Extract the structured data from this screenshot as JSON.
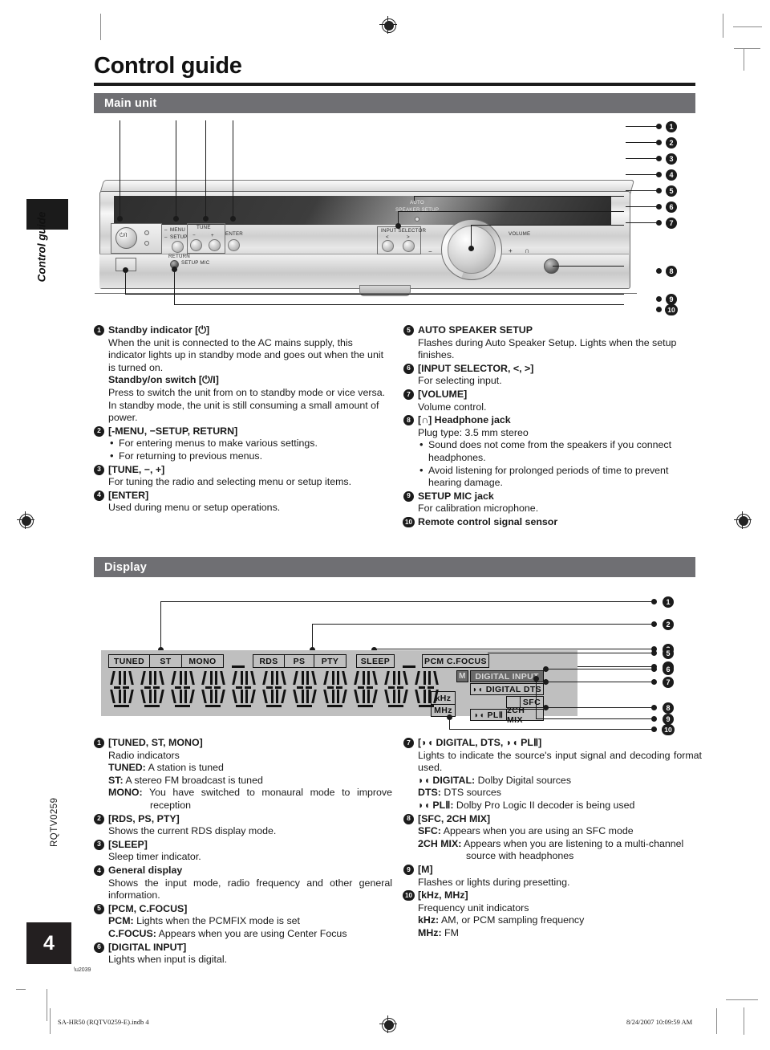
{
  "page": {
    "title": "Control guide",
    "side_tab_label": "Control guide",
    "page_number": "4",
    "doc_code": "RQTV0259"
  },
  "sections": {
    "main_unit": {
      "band_label": "Main unit"
    },
    "display": {
      "band_label": "Display"
    }
  },
  "unit_labels": {
    "menu": "MENU",
    "setup": "SETUP",
    "return": "RETURN",
    "tune": "TUNE",
    "minus": "−",
    "plus": "+",
    "enter": "ENTER",
    "setup_mic": "SETUP MIC",
    "auto": "AUTO",
    "speaker_setup": "SPEAKER SETUP",
    "input_selector": "INPUT SELECTOR",
    "left_arrow": "<",
    "right_arrow": ">",
    "volume": "VOLUME",
    "vol_minus": "−",
    "vol_plus": "+",
    "headphone": "∩",
    "power_glyph": "⏻/I",
    "standby_dot": "⏻"
  },
  "main_unit_items": [
    {
      "num": "1",
      "title": "Standby indicator [⏻]",
      "body": "When the unit is connected to the AC mains supply, this indicator lights up in standby mode and goes out when the unit is turned on.",
      "title2": "Standby/on switch [⏻/I]",
      "body2": "Press to switch the unit from on to standby mode or vice versa. In standby mode, the unit is still consuming a small amount of power."
    },
    {
      "num": "2",
      "title": "[-MENU, −SETUP, RETURN]",
      "bullets": [
        "For entering menus to make various settings.",
        "For returning to previous menus."
      ]
    },
    {
      "num": "3",
      "title": "[TUNE, −, +]",
      "body": "For tuning the radio and selecting menu or setup items."
    },
    {
      "num": "4",
      "title": "[ENTER]",
      "body": "Used during menu or setup operations."
    },
    {
      "num": "5",
      "title": "AUTO SPEAKER SETUP",
      "body": "Flashes during Auto Speaker Setup. Lights when the setup finishes."
    },
    {
      "num": "6",
      "title": "[INPUT SELECTOR, <, >]",
      "body": "For selecting input."
    },
    {
      "num": "7",
      "title": "[VOLUME]",
      "body": "Volume control."
    },
    {
      "num": "8",
      "title": "[∩] Headphone jack",
      "body": "Plug type: 3.5 mm stereo",
      "bullets": [
        "Sound does not come from the speakers if you connect headphones.",
        "Avoid listening for prolonged periods of time to prevent hearing damage."
      ]
    },
    {
      "num": "9",
      "title": "SETUP MIC jack",
      "body": "For calibration microphone."
    },
    {
      "num": "10",
      "title": "Remote control signal sensor"
    }
  ],
  "display_items": [
    {
      "num": "1",
      "title": "[TUNED, ST, MONO]",
      "body": "Radio indicators",
      "defs": [
        {
          "term": "TUNED:",
          "desc": "A station is tuned"
        },
        {
          "term": "ST:",
          "desc": "A stereo FM broadcast is tuned"
        },
        {
          "term": "MONO:",
          "desc": "You have switched to monaural mode to improve reception"
        }
      ]
    },
    {
      "num": "2",
      "title": "[RDS, PS, PTY]",
      "body": "Shows the current RDS display mode."
    },
    {
      "num": "3",
      "title": "[SLEEP]",
      "body": "Sleep timer indicator."
    },
    {
      "num": "4",
      "title": "General display",
      "body": "Shows the input mode, radio frequency and other general information."
    },
    {
      "num": "5",
      "title": "[PCM, C.FOCUS]",
      "defs": [
        {
          "term": "PCM:",
          "desc": "Lights when the PCMFIX mode is set"
        },
        {
          "term": "C.FOCUS:",
          "desc": "Appears when you are using Center Focus"
        }
      ]
    },
    {
      "num": "6",
      "title": "[DIGITAL INPUT]",
      "body": "Lights when input is digital."
    },
    {
      "num": "7",
      "title": "[◗◖ DIGITAL, DTS, ◗◖ PLⅡ]",
      "body": "Lights to indicate the source's input signal and decoding format used.",
      "defs": [
        {
          "term": "◗◖ DIGITAL:",
          "desc": "Dolby Digital sources"
        },
        {
          "term": "DTS:",
          "desc": "DTS sources"
        },
        {
          "term": "◗◖ PLⅡ:",
          "desc": "Dolby Pro Logic II decoder is being used"
        }
      ]
    },
    {
      "num": "8",
      "title": "[SFC, 2CH MIX]",
      "defs": [
        {
          "term": "SFC:",
          "desc": "Appears when you are using an SFC mode"
        },
        {
          "term": "2CH MIX:",
          "desc": "Appears when you are listening to a multi-channel source with headphones"
        }
      ]
    },
    {
      "num": "9",
      "title": "[M]",
      "body": "Flashes or lights during presetting."
    },
    {
      "num": "10",
      "title": "[kHz, MHz]",
      "body": "Frequency unit indicators",
      "defs": [
        {
          "term": "kHz:",
          "desc": "AM, or PCM sampling frequency"
        },
        {
          "term": "MHz:",
          "desc": "FM"
        }
      ]
    }
  ],
  "display_panel": {
    "indicators_row1": [
      "TUNED",
      "ST",
      "MONO"
    ],
    "indicators_row2": [
      "RDS",
      "PS",
      "PTY"
    ],
    "sleep": "SLEEP",
    "pcm_cfocus": "PCM  C.FOCUS",
    "m_flag": "M",
    "digital_input": "DIGITAL INPUT",
    "dolby_digital": "◗◖ DIGITAL   DTS",
    "sfc": "SFC",
    "pl2_2chmix_left": "◗◖ PLⅡ",
    "pl2_2chmix_right": "2CH MIX",
    "khz": "kHz",
    "mhz": "MHz",
    "digit_count": 11
  },
  "callouts": {
    "main_unit": [
      "1",
      "2",
      "3",
      "4",
      "5",
      "6",
      "7",
      "8",
      "9",
      "10"
    ],
    "display": [
      "1",
      "2",
      "3",
      "4",
      "5",
      "6",
      "7",
      "8",
      "9",
      "10"
    ]
  },
  "footer": {
    "left": "SA-HR50 (RQTV0259-E).indb   4",
    "right": "8/24/2007   10:09:59 AM"
  }
}
